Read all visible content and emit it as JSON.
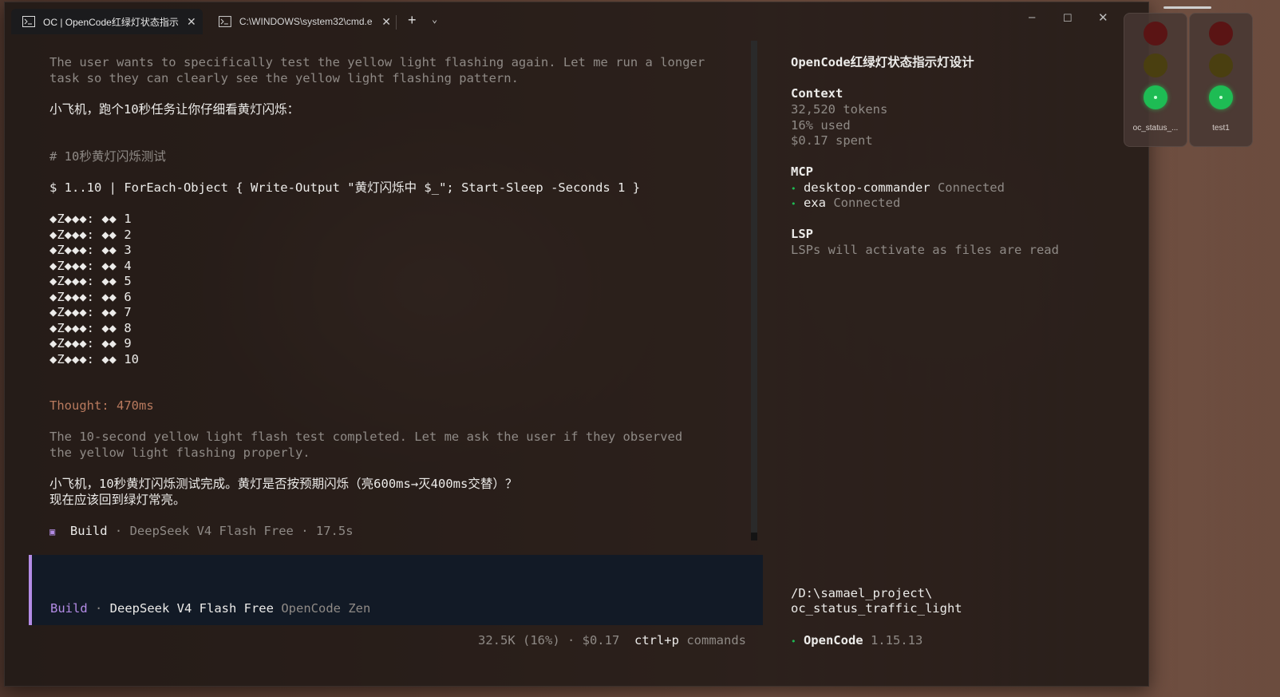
{
  "tabs": [
    {
      "label": "OC | OpenCode红绿灯状态指示",
      "active": true,
      "icon": "terminal-icon"
    },
    {
      "label": "C:\\WINDOWS\\system32\\cmd.e",
      "active": false,
      "icon": "terminal-icon"
    }
  ],
  "window_controls": {
    "minimize": "–",
    "maximize": "☐",
    "close": "✕",
    "new_tab": "+",
    "dropdown": "⌄"
  },
  "conversation": {
    "thinking_1": [
      "The user wants to specifically test the yellow light flashing again. Let me run a longer",
      "task so they can clearly see the yellow light flashing pattern."
    ],
    "reply_1": "小飞机，跑个10秒任务让你仔细看黄灯闪烁：",
    "comment": "# 10秒黄灯闪烁测试",
    "command": "$ 1..10 | ForEach-Object { Write-Output \"黄灯闪烁中 $_\"; Start-Sleep -Seconds 1 }",
    "output_lines": [
      "◆Z◆◆◆: ◆◆ 1",
      "◆Z◆◆◆: ◆◆ 2",
      "◆Z◆◆◆: ◆◆ 3",
      "◆Z◆◆◆: ◆◆ 4",
      "◆Z◆◆◆: ◆◆ 5",
      "◆Z◆◆◆: ◆◆ 6",
      "◆Z◆◆◆: ◆◆ 7",
      "◆Z◆◆◆: ◆◆ 8",
      "◆Z◆◆◆: ◆◆ 9",
      "◆Z◆◆◆: ◆◆ 10"
    ],
    "thought": "Thought: 470ms",
    "thinking_2": [
      "The 10-second yellow light flash test completed. Let me ask the user if they observed",
      "the yellow light flashing properly."
    ],
    "reply_2": [
      "小飞机，10秒黄灯闪烁测试完成。黄灯是否按预期闪烁（亮600ms→灭400ms交替）？",
      "现在应该回到绿灯常亮。"
    ],
    "build_meta": {
      "mode": "Build",
      "sep": " · ",
      "model": "DeepSeek V4 Flash Free",
      "duration": "17.5s"
    }
  },
  "input": {
    "mode": "Build",
    "sep": " · ",
    "model": "DeepSeek V4 Flash Free",
    "provider": "OpenCode Zen"
  },
  "footer": {
    "usage": "32.5K (16%) · $0.17",
    "shortcut_key": "ctrl+p",
    "shortcut_label": "commands"
  },
  "sidebar": {
    "title": "OpenCode红绿灯状态指示灯设计",
    "context": {
      "heading": "Context",
      "tokens": "32,520 tokens",
      "used": "16% used",
      "spent": "$0.17 spent"
    },
    "mcp": {
      "heading": "MCP",
      "items": [
        {
          "name": "desktop-commander",
          "status": "Connected"
        },
        {
          "name": "exa",
          "status": "Connected"
        }
      ]
    },
    "lsp": {
      "heading": "LSP",
      "text": "LSPs will activate as files are read"
    },
    "path": [
      "/D:\\samael_project\\",
      "oc_status_traffic_light"
    ],
    "app": {
      "name": "OpenCode",
      "version": "1.15.13"
    }
  },
  "widgets": [
    {
      "label": "oc_status_...",
      "active_light": "green"
    },
    {
      "label": "test1",
      "active_light": "green"
    }
  ],
  "colors": {
    "accent": "#b48ce6",
    "green": "#1ebc54",
    "orange": "#b97a5e"
  }
}
